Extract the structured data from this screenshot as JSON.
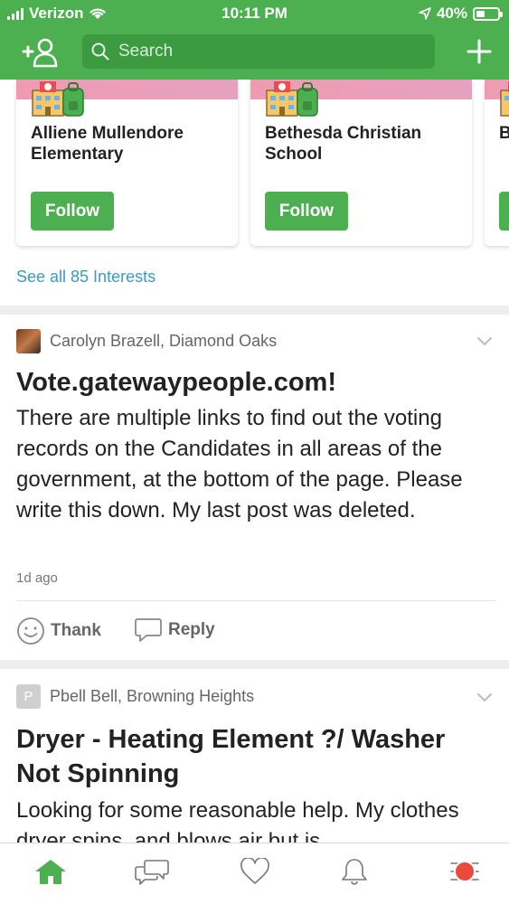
{
  "status": {
    "carrier": "Verizon",
    "time": "10:11 PM",
    "battery": "40%",
    "battery_level": 0.4
  },
  "header": {
    "search_placeholder": "Search"
  },
  "interests": {
    "cards": [
      {
        "name": "Alliene Mullendore Elementary",
        "follow": "Follow"
      },
      {
        "name": "Bethesda Christian School",
        "follow": "Follow"
      },
      {
        "name": "B",
        "follow": ""
      }
    ],
    "see_all": "See all 85 Interests"
  },
  "posts": [
    {
      "author": "Carolyn Brazell, Diamond Oaks",
      "title": "Vote.gatewaypeople.com!",
      "body": "There are multiple links to find out the voting records on the Candidates in all areas of the government, at the bottom of the page. Please write this down. My last post was deleted.",
      "time": "1d ago",
      "thank": "Thank",
      "reply": "Reply"
    },
    {
      "author": "Pbell Bell, Browning Heights",
      "avatar_letter": "P",
      "title": "Dryer - Heating Element ?/ Washer Not Spinning",
      "body": "Looking for some reasonable help. My clothes dryer spins, and blows air but is"
    }
  ],
  "colors": {
    "brand": "#4cb050",
    "search_bg": "#3c9a40",
    "link": "#3f97c6",
    "badge": "#e84b3c"
  }
}
